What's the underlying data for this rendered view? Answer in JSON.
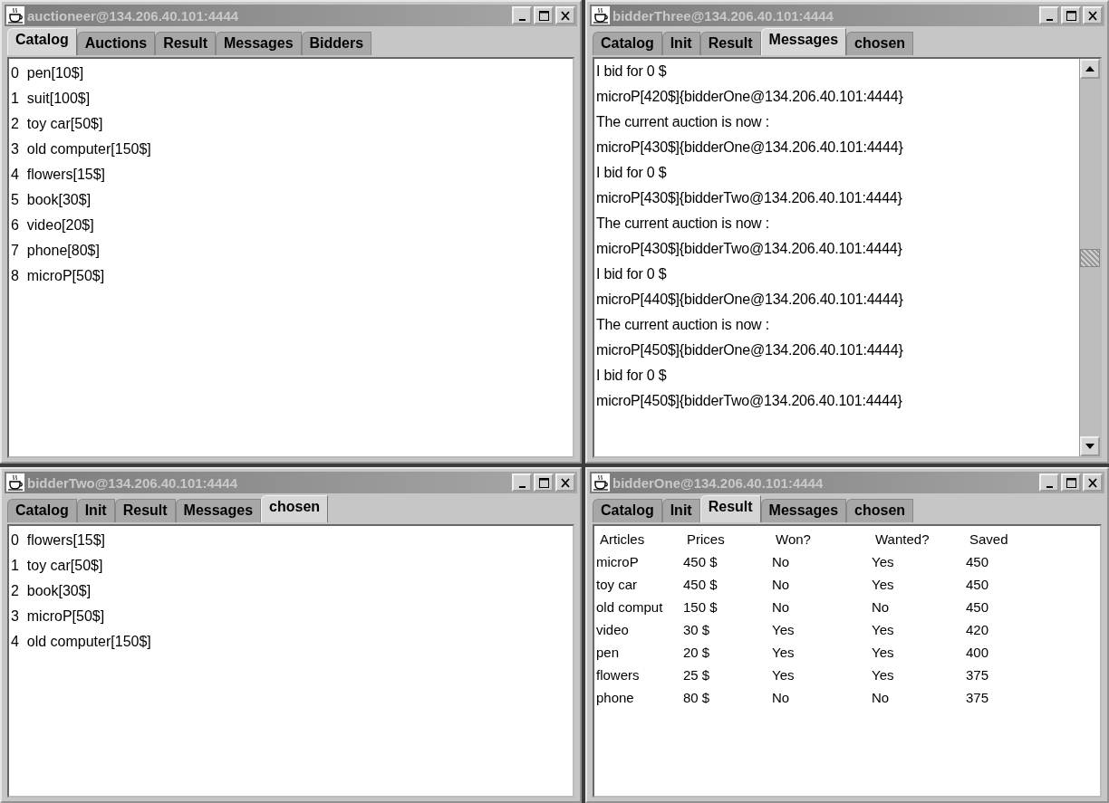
{
  "windows": [
    {
      "title": "auctioneer@134.206.40.101:4444",
      "tabs": [
        {
          "label": "Catalog",
          "selected": true
        },
        {
          "label": "Auctions",
          "selected": false
        },
        {
          "label": "Result",
          "selected": false
        },
        {
          "label": "Messages",
          "selected": false
        },
        {
          "label": "Bidders",
          "selected": false
        }
      ],
      "content": {
        "kind": "list",
        "items": [
          "0  pen[10$]",
          "1  suit[100$]",
          "2  toy car[50$]",
          "3  old computer[150$]",
          "4  flowers[15$]",
          "5  book[30$]",
          "6  video[20$]",
          "7  phone[80$]",
          "8  microP[50$]"
        ]
      }
    },
    {
      "title": "bidderThree@134.206.40.101:4444",
      "tabs": [
        {
          "label": "Catalog",
          "selected": false
        },
        {
          "label": "Init",
          "selected": false
        },
        {
          "label": "Result",
          "selected": false
        },
        {
          "label": "Messages",
          "selected": true
        },
        {
          "label": "chosen",
          "selected": false
        }
      ],
      "content": {
        "kind": "messages",
        "items": [
          "I bid for 0 $",
          "microP[420$]{bidderOne@134.206.40.101:4444}",
          "The current auction is now :",
          "microP[430$]{bidderOne@134.206.40.101:4444}",
          "I bid for 0 $",
          "microP[430$]{bidderTwo@134.206.40.101:4444}",
          "The current auction is now :",
          "microP[430$]{bidderTwo@134.206.40.101:4444}",
          "I bid for 0 $",
          "microP[440$]{bidderOne@134.206.40.101:4444}",
          "The current auction is now :",
          "microP[450$]{bidderOne@134.206.40.101:4444}",
          "I bid for 0 $",
          "microP[450$]{bidderTwo@134.206.40.101:4444}"
        ]
      }
    },
    {
      "title": "bidderTwo@134.206.40.101:4444",
      "tabs": [
        {
          "label": "Catalog",
          "selected": false
        },
        {
          "label": "Init",
          "selected": false
        },
        {
          "label": "Result",
          "selected": false
        },
        {
          "label": "Messages",
          "selected": false
        },
        {
          "label": "chosen",
          "selected": true
        }
      ],
      "content": {
        "kind": "list",
        "items": [
          "0  flowers[15$]",
          "1  toy car[50$]",
          "2  book[30$]",
          "3  microP[50$]",
          "4  old computer[150$]"
        ]
      }
    },
    {
      "title": "bidderOne@134.206.40.101:4444",
      "tabs": [
        {
          "label": "Catalog",
          "selected": false
        },
        {
          "label": "Init",
          "selected": false
        },
        {
          "label": "Result",
          "selected": true
        },
        {
          "label": "Messages",
          "selected": false
        },
        {
          "label": "chosen",
          "selected": false
        }
      ],
      "content": {
        "kind": "table",
        "columns": [
          "Articles",
          "Prices",
          "Won?",
          "Wanted?",
          "Saved"
        ],
        "rows": [
          [
            "microP",
            "450 $",
            "No",
            "Yes",
            "450"
          ],
          [
            "toy car",
            "450 $",
            "No",
            "Yes",
            "450"
          ],
          [
            "old comput",
            "150 $",
            "No",
            "No",
            "450"
          ],
          [
            "video",
            "30 $",
            "Yes",
            "Yes",
            "420"
          ],
          [
            "pen",
            "20 $",
            "Yes",
            "Yes",
            "400"
          ],
          [
            "flowers",
            "25 $",
            "Yes",
            "Yes",
            "375"
          ],
          [
            "phone",
            "80 $",
            "No",
            "No",
            "375"
          ]
        ]
      }
    }
  ]
}
